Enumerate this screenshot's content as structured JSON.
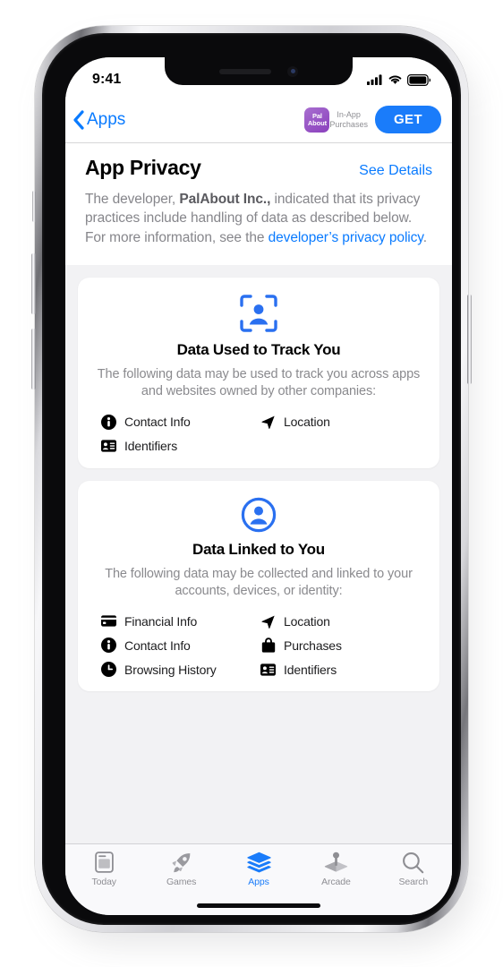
{
  "status_bar": {
    "time": "9:41",
    "icons": [
      "cellular-signal-icon",
      "wifi-icon",
      "battery-icon"
    ]
  },
  "nav_bar": {
    "back_label": "Apps",
    "back_icon": "chevron-left-icon",
    "app_icon_line1": "Pal",
    "app_icon_line2": "About",
    "iap_label": "In-App\nPurchases",
    "get_label": "GET",
    "get_color": "#1a7cfa"
  },
  "header": {
    "title": "App Privacy",
    "see_details": "See Details",
    "intro_part1": "The developer, ",
    "intro_developer": "PalAbout Inc.,",
    "intro_part2": " indicated that its privacy practices include handling of data as described below. For more information, see the ",
    "intro_link": "developer’s privacy policy",
    "intro_part3": "."
  },
  "cards": [
    {
      "icon": "person-in-viewfinder-icon",
      "title": "Data Used to Track You",
      "description": "The following data may be used to track you across apps and websites owned by other companies:",
      "items": [
        {
          "label": "Contact Info",
          "icon": "info-circle-icon"
        },
        {
          "label": "Location",
          "icon": "location-arrow-icon"
        },
        {
          "label": "Identifiers",
          "icon": "contact-card-icon"
        }
      ]
    },
    {
      "icon": "person-circle-icon",
      "title": "Data Linked to You",
      "description": "The following data may be collected and linked to your accounts, devices, or identity:",
      "items": [
        {
          "label": "Financial Info",
          "icon": "credit-card-icon"
        },
        {
          "label": "Location",
          "icon": "location-arrow-icon"
        },
        {
          "label": "Contact Info",
          "icon": "info-circle-icon"
        },
        {
          "label": "Purchases",
          "icon": "shopping-bag-icon"
        },
        {
          "label": "Browsing History",
          "icon": "clock-icon"
        },
        {
          "label": "Identifiers",
          "icon": "contact-card-icon"
        }
      ]
    }
  ],
  "tab_bar": {
    "active_color": "#1a7cfa",
    "inactive_color": "#8e8e93",
    "tabs": [
      {
        "label": "Today",
        "icon": "today-card-icon",
        "active": false
      },
      {
        "label": "Games",
        "icon": "rocket-icon",
        "active": false
      },
      {
        "label": "Apps",
        "icon": "layers-icon",
        "active": true
      },
      {
        "label": "Arcade",
        "icon": "arcade-joystick-icon",
        "active": false
      },
      {
        "label": "Search",
        "icon": "magnifier-icon",
        "active": false
      }
    ]
  },
  "accent_blue": "#0a7bff"
}
